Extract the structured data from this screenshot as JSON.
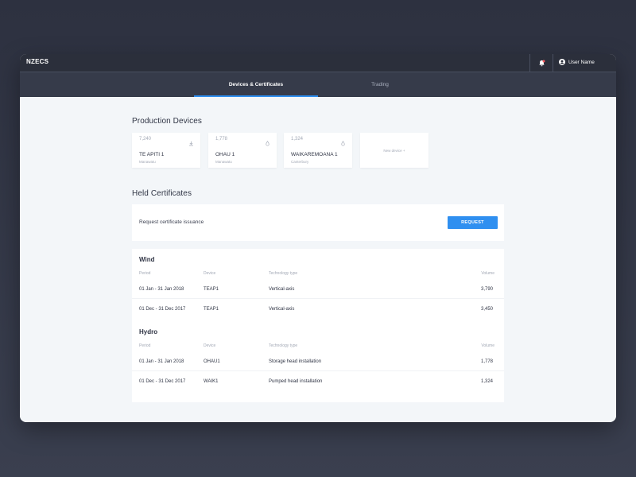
{
  "app": {
    "brand": "NZECS",
    "user_name": "User Name"
  },
  "tabs": [
    {
      "label": "Devices & Certificates",
      "active": true
    },
    {
      "label": "Trading",
      "active": false
    }
  ],
  "production": {
    "title": "Production Devices",
    "devices": [
      {
        "value": "7,240",
        "icon": "wind-download-icon",
        "name": "TE APITI 1",
        "region": "Manawatu"
      },
      {
        "value": "1,778",
        "icon": "water-drop-icon",
        "name": "OHAU 1",
        "region": "Manawatu"
      },
      {
        "value": "1,324",
        "icon": "water-drop-icon",
        "name": "WAIKAREMOANA 1",
        "region": "Canterbury"
      }
    ],
    "new_device_label": "New device +"
  },
  "held": {
    "title": "Held Certificates",
    "request_label": "Request certificate issuance",
    "request_button": "REQUEST"
  },
  "table": {
    "headers": {
      "period": "Period",
      "device": "Device",
      "tech": "Technology type",
      "volume": "Volume"
    },
    "groups": [
      {
        "name": "Wind",
        "rows": [
          {
            "period": "01 Jan - 31 Jan 2018",
            "device": "TEAP1",
            "tech": "Vertical-axis",
            "volume": "3,790"
          },
          {
            "period": "01 Dec - 31 Dec 2017",
            "device": "TEAP1",
            "tech": "Vertical-axis",
            "volume": "3,450"
          }
        ]
      },
      {
        "name": "Hydro",
        "rows": [
          {
            "period": "01 Jan - 31 Jan 2018",
            "device": "OHAU1",
            "tech": "Storage head installation",
            "volume": "1,778"
          },
          {
            "period": "01 Dec - 31 Dec 2017",
            "device": "WAIK1",
            "tech": "Pumped head installation",
            "volume": "1,324"
          }
        ]
      }
    ]
  },
  "colors": {
    "accent": "#2f8ff0",
    "bell": "#ff5a5f",
    "topbar": "#2b2f3b",
    "tabbar": "#363b4a"
  }
}
